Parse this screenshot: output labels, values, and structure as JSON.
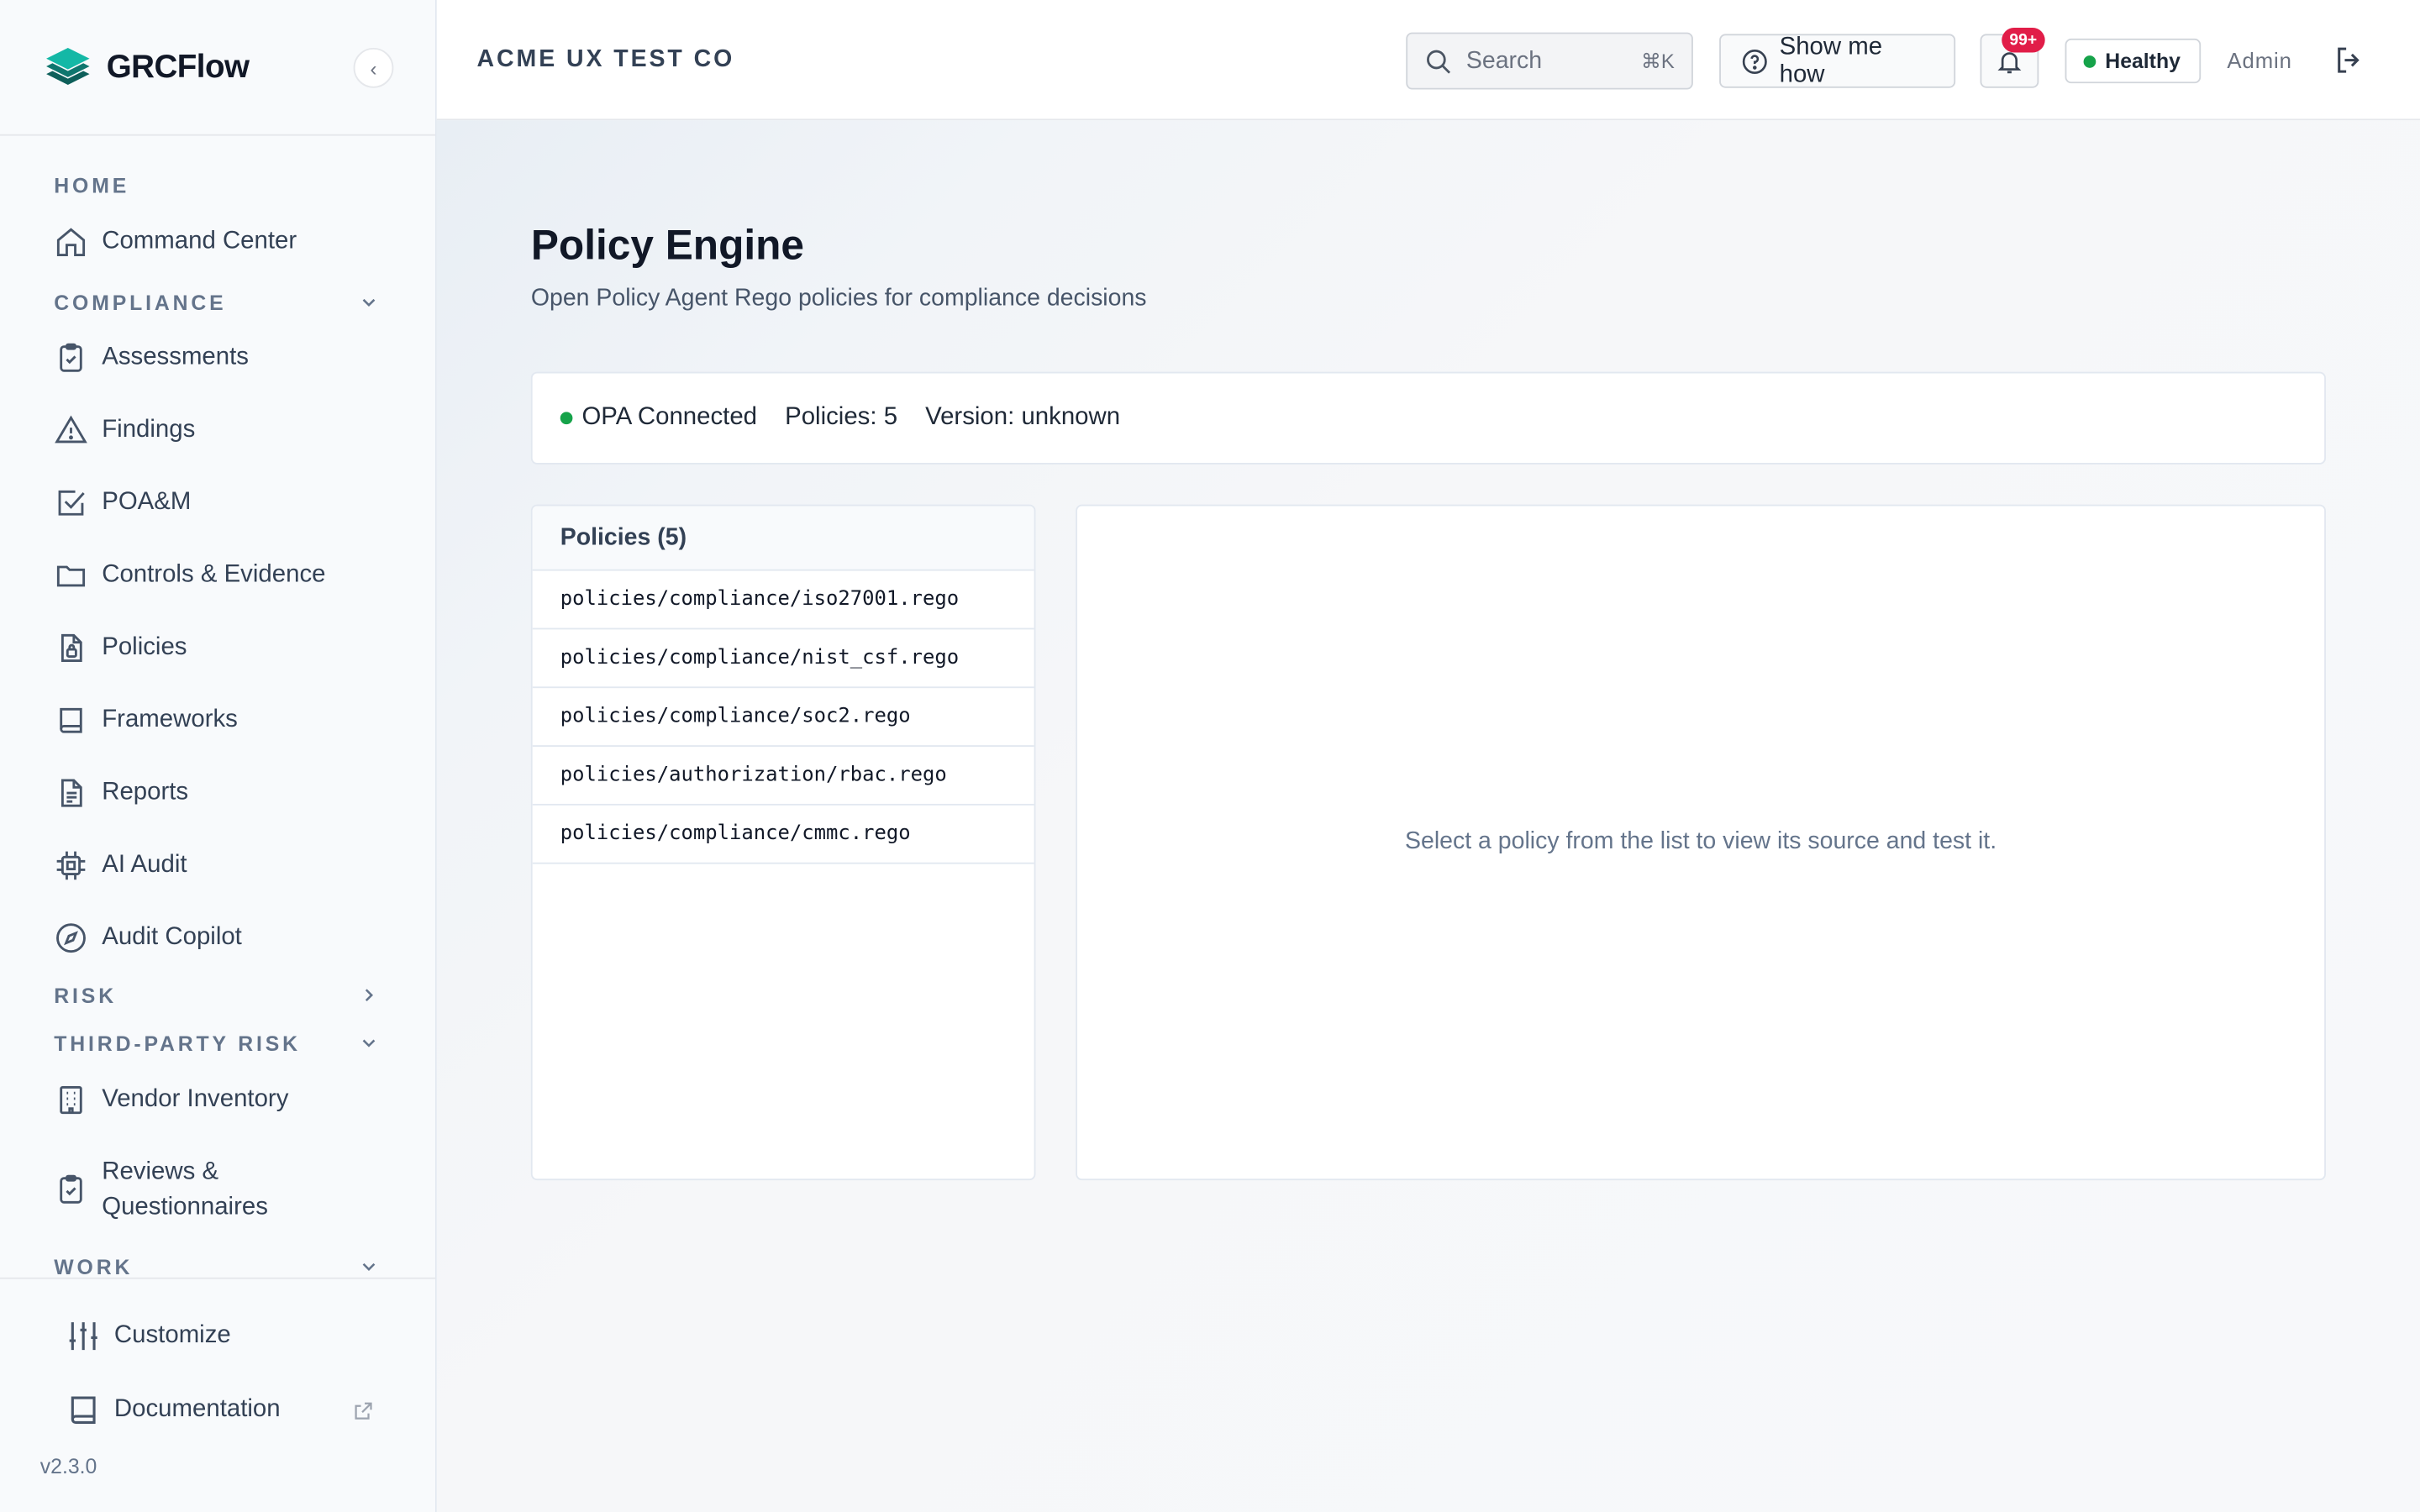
{
  "app": {
    "name": "GRCFlow",
    "version": "v2.3.0"
  },
  "sidebar": {
    "collapse_glyph": "‹",
    "sections": {
      "home": "HOME",
      "compliance": "COMPLIANCE",
      "risk": "RISK",
      "third_party_risk": "THIRD-PARTY RISK",
      "work": "WORK"
    },
    "items": {
      "command_center": "Command Center",
      "assessments": "Assessments",
      "findings": "Findings",
      "poam": "POA&M",
      "controls_evidence": "Controls & Evidence",
      "policies": "Policies",
      "frameworks": "Frameworks",
      "reports": "Reports",
      "ai_audit": "AI Audit",
      "audit_copilot": "Audit Copilot",
      "vendor_inventory": "Vendor Inventory",
      "reviews_line1": "Reviews &",
      "reviews_line2": "Questionnaires"
    },
    "footer": {
      "customize": "Customize",
      "documentation": "Documentation"
    }
  },
  "topbar": {
    "org": "ACME UX TEST CO",
    "search_placeholder": "Search",
    "search_shortcut": "⌘K",
    "show_me_how": "Show me how",
    "notification_count": "99+",
    "health": "Healthy",
    "user": "Admin"
  },
  "page": {
    "title": "Policy Engine",
    "subtitle": "Open Policy Agent Rego policies for compliance decisions",
    "status": {
      "connection": "OPA Connected",
      "policies": "Policies: 5",
      "version": "Version: unknown"
    },
    "list_header": "Policies (5)",
    "policies": [
      "policies/compliance/iso27001.rego",
      "policies/compliance/nist_csf.rego",
      "policies/compliance/soc2.rego",
      "policies/authorization/rbac.rego",
      "policies/compliance/cmmc.rego"
    ],
    "empty_state": "Select a policy from the list to view its source and test it."
  },
  "colors": {
    "brand": "#0f766e",
    "status_ok": "#16a34a",
    "badge": "#e11d48"
  }
}
